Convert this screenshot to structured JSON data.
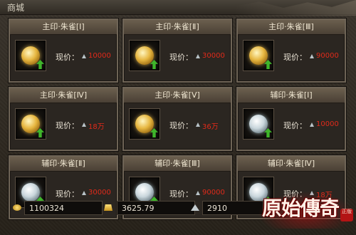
{
  "window": {
    "title": "商城"
  },
  "items": [
    {
      "name": "主印·朱雀[Ⅰ]",
      "price_label": "现价：",
      "price": "10000",
      "seal": "gold"
    },
    {
      "name": "主印·朱雀[Ⅱ]",
      "price_label": "现价：",
      "price": "30000",
      "seal": "gold"
    },
    {
      "name": "主印·朱雀[Ⅲ]",
      "price_label": "现价：",
      "price": "90000",
      "seal": "gold"
    },
    {
      "name": "主印·朱雀[Ⅳ]",
      "price_label": "现价：",
      "price": "18万",
      "seal": "gold"
    },
    {
      "name": "主印·朱雀[Ⅴ]",
      "price_label": "现价：",
      "price": "36万",
      "seal": "gold"
    },
    {
      "name": "辅印·朱雀[Ⅰ]",
      "price_label": "现价：",
      "price": "10000",
      "seal": "silver"
    },
    {
      "name": "辅印·朱雀[Ⅱ]",
      "price_label": "现价：",
      "price": "30000",
      "seal": "silver"
    },
    {
      "name": "辅印·朱雀[Ⅲ]",
      "price_label": "现价：",
      "price": "90000",
      "seal": "silver"
    },
    {
      "name": "辅印·朱雀[Ⅳ]",
      "price_label": "现价：",
      "price": "18万",
      "seal": "silver"
    }
  ],
  "currency": {
    "coins": "1100324",
    "gold": "3625.79",
    "silver": "2910"
  },
  "logo": {
    "text": "原始傳奇",
    "stamp": "正版"
  },
  "colors": {
    "price": "#e02a1a",
    "arrow": "#3fb52b"
  }
}
